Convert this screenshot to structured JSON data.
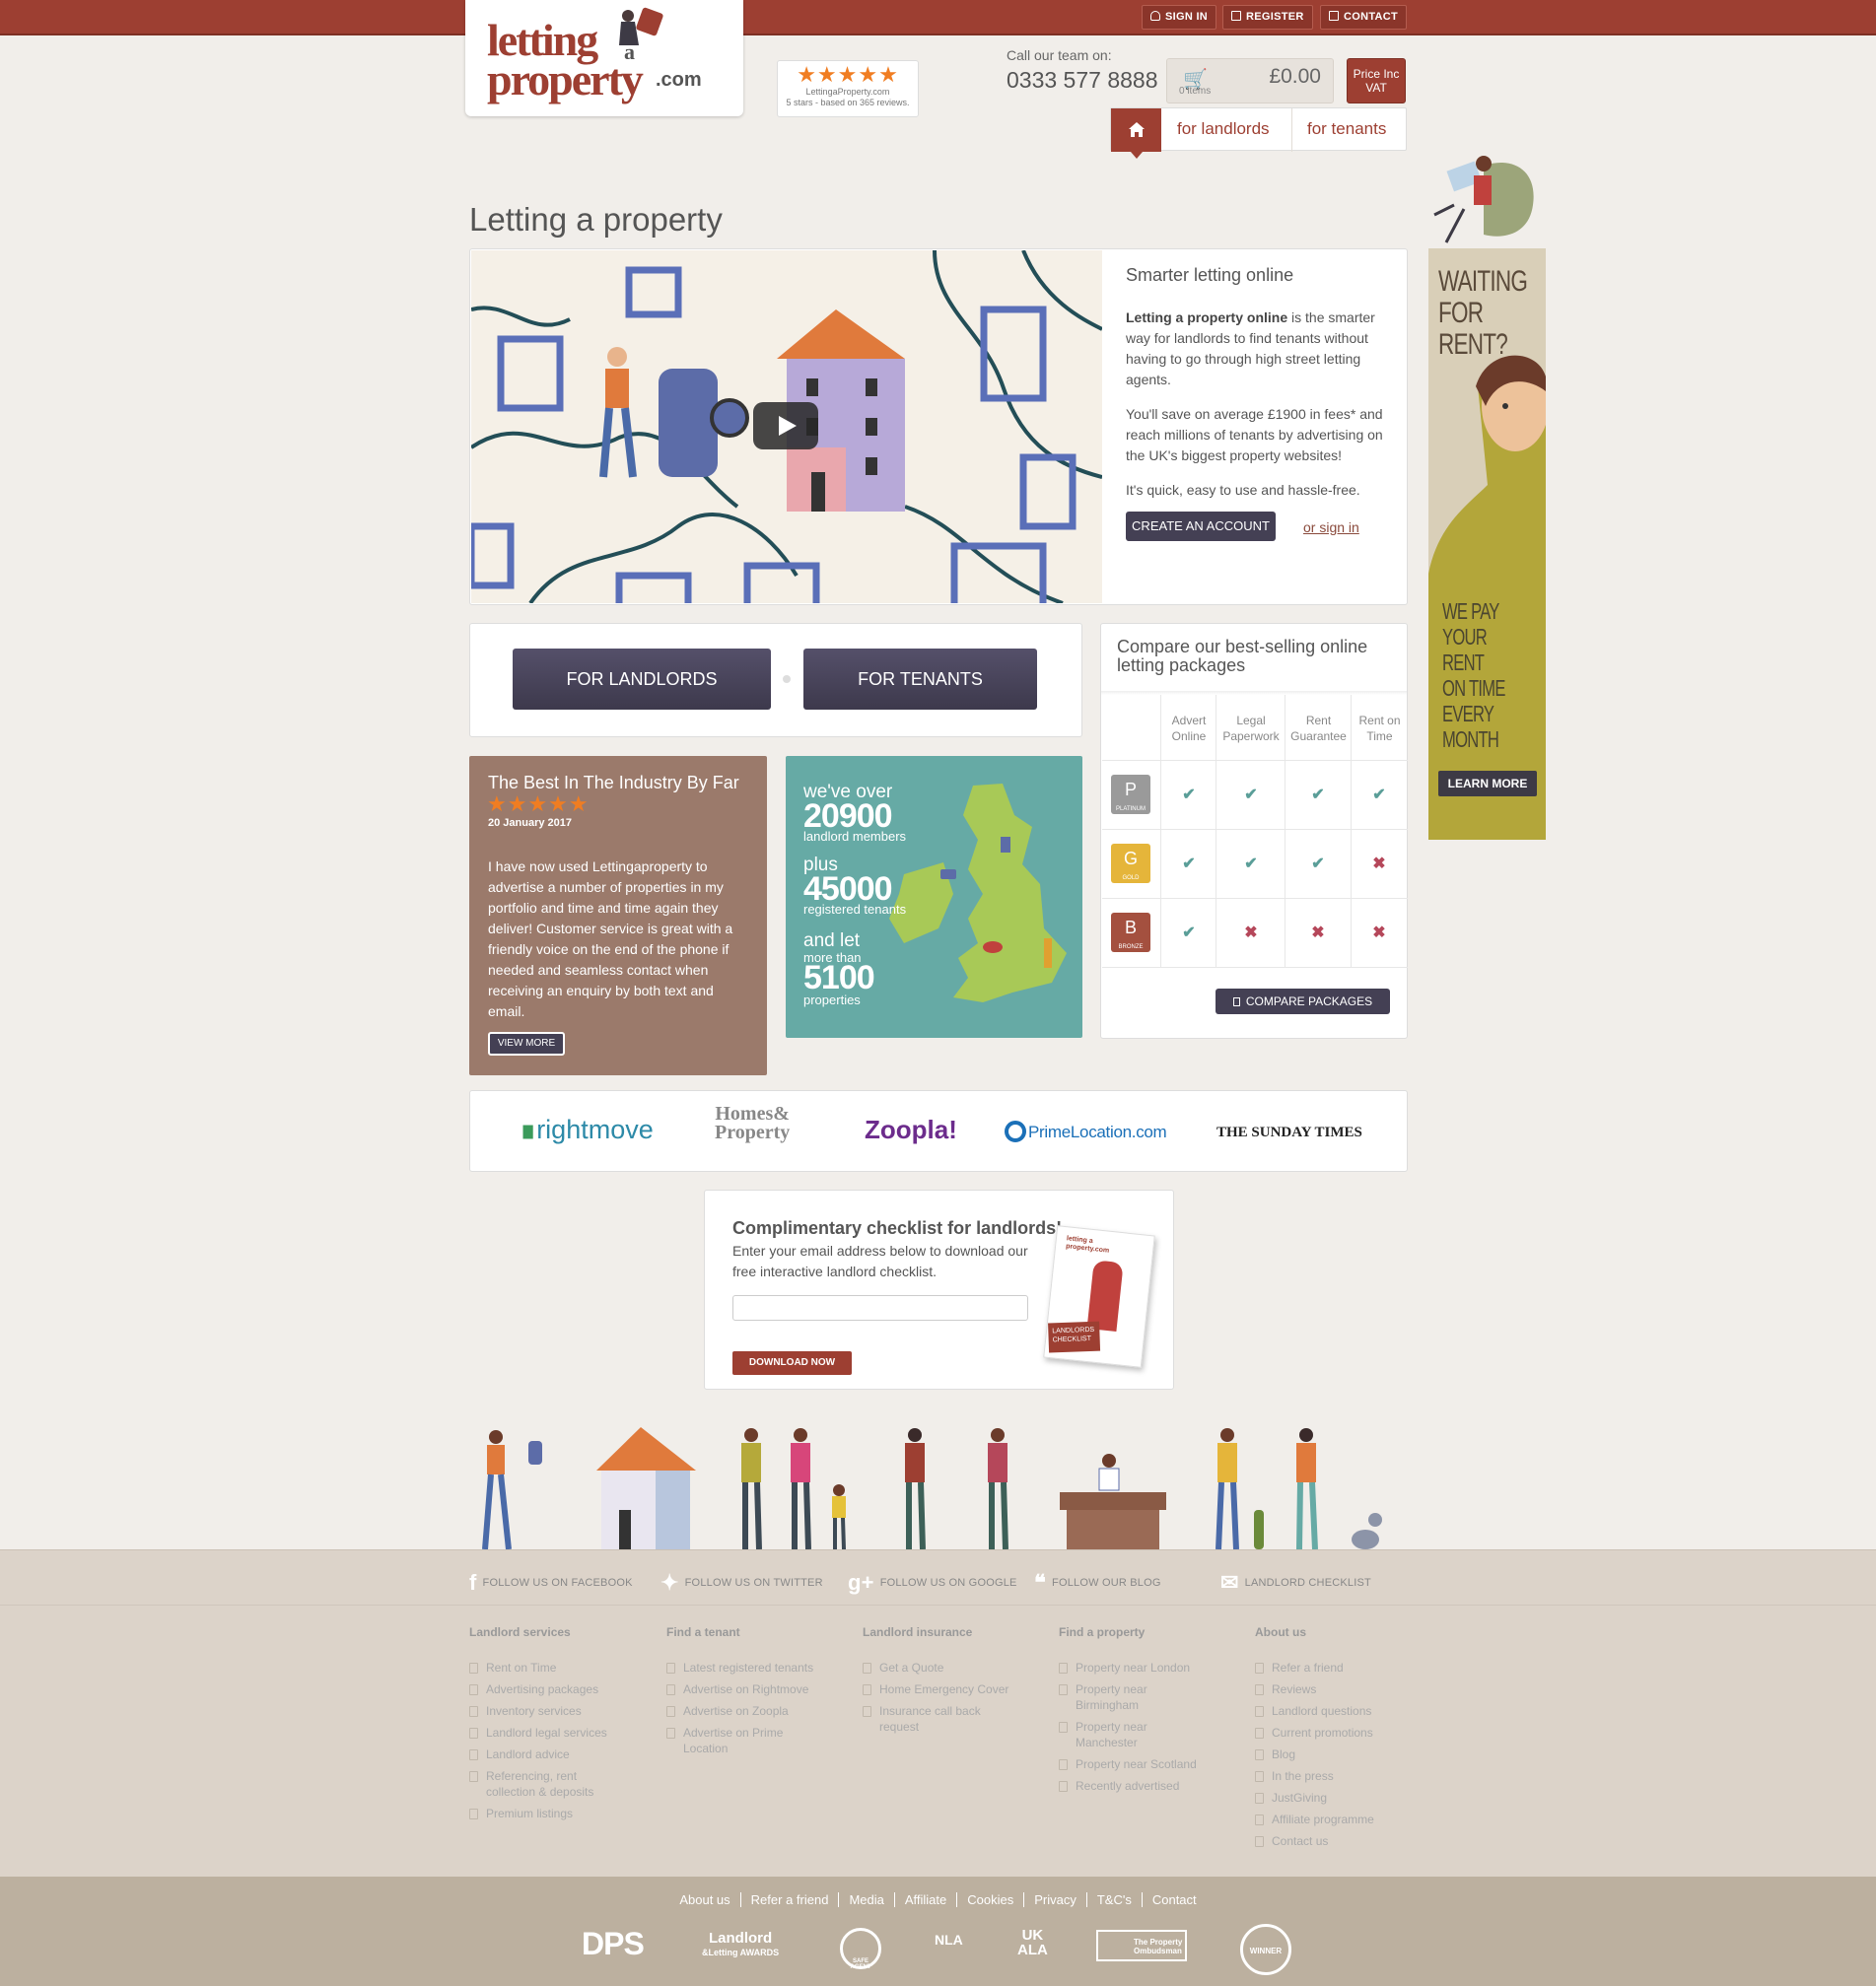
{
  "topbar": {
    "signin": "SIGN IN",
    "register": "REGISTER",
    "contact": "CONTACT"
  },
  "logo": {
    "line1": "letting",
    "a": "a",
    "line2": "property",
    "com": ".com"
  },
  "rating": {
    "stars": "★★★★★",
    "site": "LettingaProperty.com",
    "summary": "5 stars - based on 365 reviews."
  },
  "header": {
    "call_label": "Call our team on:",
    "phone": "0333 577 8888",
    "basket_items": "0 items",
    "basket_total": "£0.00",
    "vat_label": "Price Inc VAT"
  },
  "nav": {
    "home_icon": "home-icon",
    "landlords": "for landlords",
    "tenants": "for tenants"
  },
  "page_title": "Letting a property",
  "hero": {
    "heading": "Smarter letting online",
    "p1_bold": "Letting a property online",
    "p1_rest": " is the smarter way for landlords to find tenants without having to go through high street letting agents.",
    "p2": "You'll save on average £1900 in fees* and reach millions of tenants by advertising on the UK's biggest property websites!",
    "p3": "It's quick, easy to use and hassle-free.",
    "create_btn": "CREATE AN ACCOUNT",
    "signin_link": "or sign in"
  },
  "chooser": {
    "landlords": "FOR LANDLORDS",
    "tenants": "FOR TENANTS"
  },
  "review": {
    "title": "The Best In The Industry By Far",
    "stars": "★★★★★",
    "date": "20 January 2017",
    "text": "I have now used Lettingaproperty to advertise a number of properties in my portfolio and time and time again they deliver! Customer service is great with a friendly voice on the end of the phone if needed and seamless contact when receiving an enquiry by both text and email.",
    "more": "VIEW MORE"
  },
  "stats": {
    "l1": "we've over",
    "n1": "20900",
    "s1": "landlord members",
    "l2": "plus",
    "n2": "45000",
    "s2": "registered tenants",
    "l3": "and let",
    "l3b": "more than",
    "n3": "5100",
    "s3": "properties"
  },
  "packages": {
    "title": "Compare our best-selling online letting packages",
    "columns": [
      "Advert Online",
      "Legal Paperwork",
      "Rent Guarantee",
      "Rent on Time"
    ],
    "rows": [
      {
        "letter": "P",
        "name": "PLATINUM",
        "color": "#9a9a9a",
        "marks": [
          "✔",
          "✔",
          "✔",
          "✔"
        ]
      },
      {
        "letter": "G",
        "name": "GOLD",
        "color": "#e5b53a",
        "marks": [
          "✔",
          "✔",
          "✔",
          "✖"
        ]
      },
      {
        "letter": "B",
        "name": "BRONZE",
        "color": "#a4503f",
        "marks": [
          "✔",
          "✖",
          "✖",
          "✖"
        ]
      }
    ],
    "compare_btn": "COMPARE PACKAGES"
  },
  "partners": {
    "rightmove": "rightmove",
    "homes": "Homes&",
    "homes2": "Property",
    "zoopla": "Zoopla!",
    "prime": "PrimeLocation.com",
    "times": "THE SUNDAY TIMES"
  },
  "checklist": {
    "title": "Complimentary checklist for landlords!",
    "text": "Enter your email address below to download our free interactive landlord checklist.",
    "download": "DOWNLOAD NOW",
    "booklet_brand": "letting a property.com",
    "booklet_label": "LANDLORDS CHECKLIST"
  },
  "ad": {
    "headline1": "WAITING",
    "headline2": "FOR RENT?",
    "tag1": "WE PAY",
    "tag2": "YOUR RENT",
    "tag3": "ON TIME",
    "tag4": "EVERY MONTH",
    "cta": "LEARN MORE"
  },
  "social": [
    "FOLLOW US ON FACEBOOK",
    "FOLLOW US ON TWITTER",
    "FOLLOW US ON GOOGLE",
    "FOLLOW OUR BLOG",
    "LANDLORD CHECKLIST"
  ],
  "footer_cols": [
    {
      "title": "Landlord services",
      "items": [
        "Rent on Time",
        "Advertising packages",
        "Inventory services",
        "Landlord legal services",
        "Landlord advice",
        "Referencing, rent collection & deposits",
        "Premium listings"
      ]
    },
    {
      "title": "Find a tenant",
      "items": [
        "Latest registered tenants",
        "Advertise on Rightmove",
        "Advertise on Zoopla",
        "Advertise on Prime Location"
      ]
    },
    {
      "title": "Landlord insurance",
      "items": [
        "Get a Quote",
        "Home Emergency Cover",
        "Insurance call back request"
      ]
    },
    {
      "title": "Find a property",
      "items": [
        "Property near London",
        "Property near Birmingham",
        "Property near Manchester",
        "Property near Scotland",
        "Recently advertised"
      ]
    },
    {
      "title": "About us",
      "items": [
        "Refer a friend",
        "Reviews",
        "Landlord questions",
        "Current promotions",
        "Blog",
        "In the press",
        "JustGiving",
        "Affiliate programme",
        "Contact us"
      ]
    }
  ],
  "bottom_links": [
    "About us",
    "Refer a friend",
    "Media",
    "Affiliate",
    "Cookies",
    "Privacy",
    "T&C's",
    "Contact"
  ],
  "accreditations": {
    "dps": "DPS",
    "awards1": "Landlord",
    "awards2": "&Letting AWARDS",
    "safeagent": "SAFE AGENT",
    "nla": "NLA",
    "ukala1": "UK",
    "ukala2": "ALA",
    "ombudsman": "The Property Ombudsman",
    "winner": "WINNER"
  },
  "colors": {
    "brand": "#9d3f32",
    "dark_button": "#444054",
    "teal": "#66aaa5",
    "check": "#5a9e98",
    "cross": "#b5475a"
  }
}
